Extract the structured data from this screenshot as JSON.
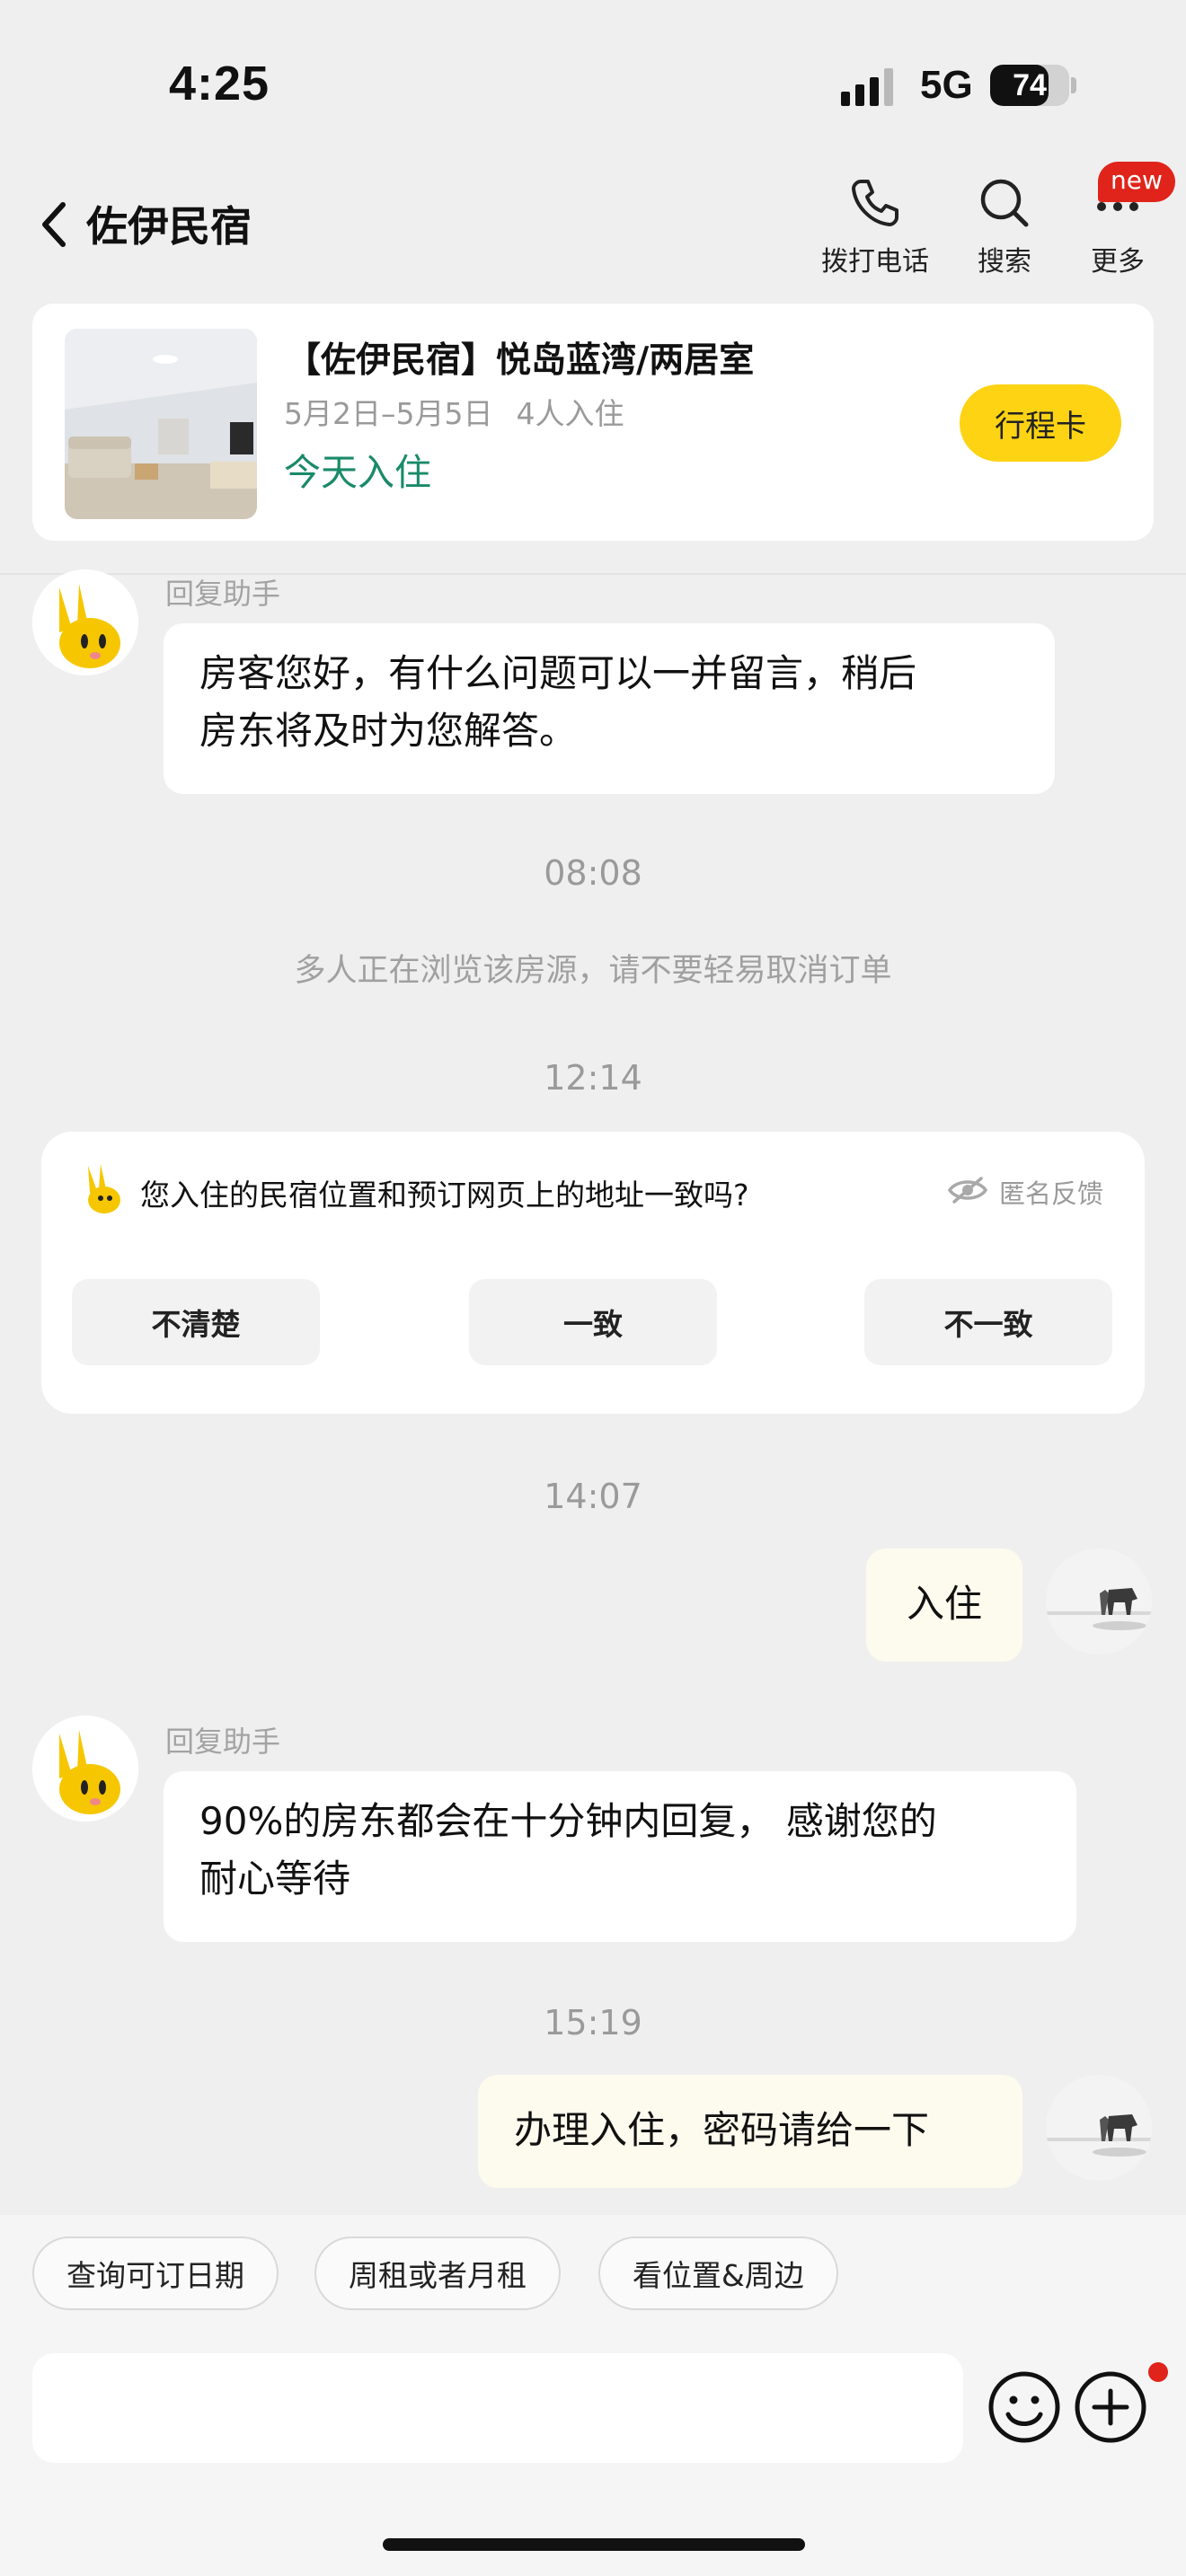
{
  "status_bar": {
    "time": "4:25",
    "network": "5G",
    "battery": "74",
    "battery_level": 0.74
  },
  "nav": {
    "title": "佐伊民宿",
    "actions": [
      {
        "label": "拨打电话",
        "icon": "phone-icon"
      },
      {
        "label": "搜索",
        "icon": "search-icon"
      },
      {
        "label": "更多",
        "icon": "more-icon"
      }
    ],
    "badge": "new"
  },
  "booking": {
    "title": "【佐伊民宿】悦岛蓝湾/两居室",
    "dates": "5月2日–5月5日",
    "guests": "4人入住",
    "status": "今天入住",
    "trip_button": "行程卡"
  },
  "messages": {
    "m1_sender": "回复助手",
    "m1_text_line1": "房客您好，有什么问题可以一并留言，稍后",
    "m1_text_line2": "房东将及时为您解答。",
    "t1": "08:08",
    "sys1": "多人正在浏览该房源，请不要轻易取消订单",
    "t2": "12:14",
    "t3": "14:07",
    "me1": "入住",
    "m2_sender": "回复助手",
    "m2_text_line1": "90%的房东都会在十分钟内回复， 感谢您的",
    "m2_text_line2": "耐心等待",
    "t4": "15:19",
    "me2": "办理入住，密码请给一下"
  },
  "survey": {
    "question": "您入住的民宿位置和预订网页上的地址一致吗?",
    "anonymous": "匿名反馈",
    "options": [
      "不清楚",
      "一致",
      "不一致"
    ]
  },
  "quick_replies": [
    "查询可订日期",
    "周租或者月租",
    "看位置&周边"
  ],
  "composer": {
    "placeholder": "",
    "emoji_icon": "smile-icon",
    "plus_icon": "plus-icon"
  },
  "colors": {
    "accent": "#fdd313",
    "status_green": "#1a8a68",
    "badge_red": "#e0241b",
    "my_bubble": "#fdfbee"
  }
}
